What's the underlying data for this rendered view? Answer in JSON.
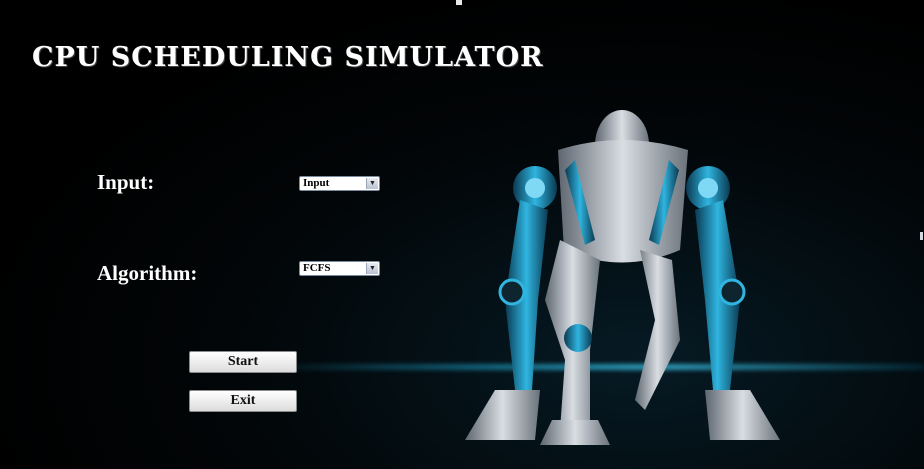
{
  "app": {
    "title": "CPU SCHEDULING SIMULATOR"
  },
  "form": {
    "input_label": "Input:",
    "input_value": "Input",
    "algorithm_label": "Algorithm:",
    "algorithm_value": "FCFS"
  },
  "buttons": {
    "start": "Start",
    "exit": "Exit"
  },
  "icons": {
    "dropdown": "chevron-down-icon"
  },
  "colors": {
    "background": "#000000",
    "accent": "#2fb5e0",
    "text": "#ffffff"
  }
}
